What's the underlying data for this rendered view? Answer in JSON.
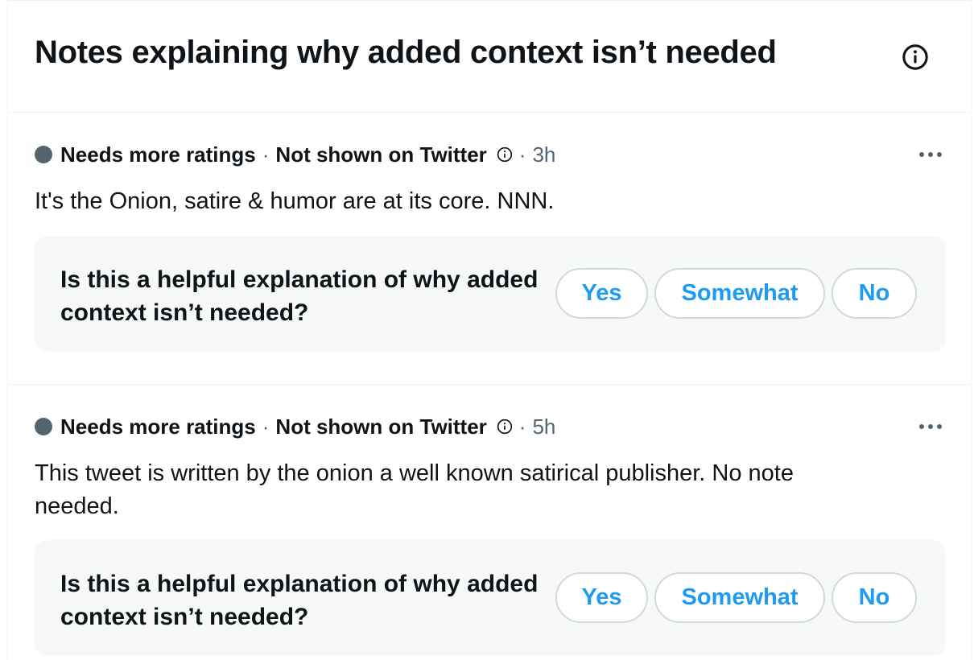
{
  "header": {
    "title": "Notes explaining why added context isn’t needed",
    "info_icon": "info-circle-icon"
  },
  "notes": [
    {
      "status": "Needs more ratings",
      "separator": "·",
      "visibility": "Not shown on Twitter",
      "time": "3h",
      "text": "It's the Onion, satire & humor are at its core. NNN.",
      "question": "Is this a helpful explanation of why added context isn’t needed?",
      "buttons": {
        "yes": "Yes",
        "somewhat": "Somewhat",
        "no": "No"
      }
    },
    {
      "status": "Needs more ratings",
      "separator": "·",
      "visibility": "Not shown on Twitter",
      "time": "5h",
      "text": "This tweet is written by the onion a well known satirical publisher. No note needed.",
      "question": "Is this a helpful explanation of why added context isn’t needed?",
      "buttons": {
        "yes": "Yes",
        "somewhat": "Somewhat",
        "no": "No"
      }
    }
  ],
  "colors": {
    "accent": "#1d9bf0",
    "text": "#0f1419",
    "secondary": "#536471",
    "border": "#eff3f4",
    "rating_bg": "#f7f9f9"
  }
}
